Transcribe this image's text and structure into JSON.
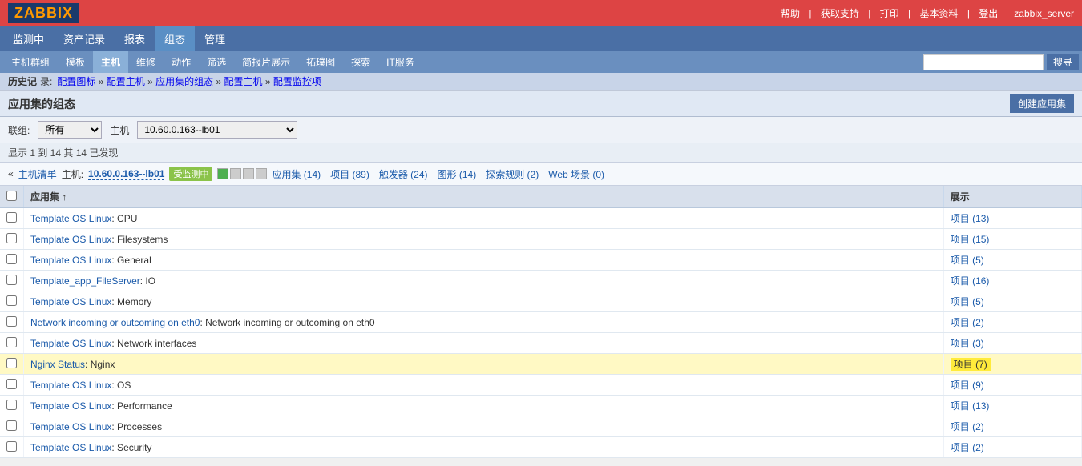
{
  "topBar": {
    "logo": "ZABBIX",
    "links": [
      "帮助",
      "获取支持",
      "打印",
      "基本资料",
      "登出"
    ],
    "serverName": "zabbix_server"
  },
  "mainNav": {
    "items": [
      "监测中",
      "资产记录",
      "报表",
      "组态",
      "管理"
    ],
    "activeIndex": 3
  },
  "subNav": {
    "items": [
      "主机群组",
      "模板",
      "主机",
      "维修",
      "动作",
      "筛选",
      "简报片展示",
      "拓璞图",
      "探索",
      "IT服务"
    ],
    "activeIndex": 2,
    "searchPlaceholder": "",
    "searchButton": "搜寻"
  },
  "breadcrumb": {
    "title": "历史记",
    "label": "录:",
    "items": [
      "配置图标",
      "配置主机",
      "应用集的组态",
      "配置主机",
      "配置监控项"
    ]
  },
  "pageSection": {
    "title": "应用集的组态",
    "createButton": "创建应用集"
  },
  "filterBar": {
    "groupLabel": "联组:",
    "groupValue": "所有",
    "hostLabel": "主机",
    "hostValue": "10.60.0.163--lb01",
    "groupOptions": [
      "所有"
    ],
    "hostOptions": [
      "10.60.0.163--lb01"
    ]
  },
  "infoBar": {
    "text": "显示 1 到 14 其 14 已发现"
  },
  "hostNav": {
    "prefix": "«",
    "listLabel": "主机清单",
    "separator1": "主机:",
    "hostLink": "10.60.0.163--lb01",
    "monitoringLabel": "受监测中",
    "statusIcons": [
      "green",
      "gray",
      "gray",
      "gray"
    ],
    "links": [
      {
        "label": "应用集 (14)",
        "count": 14
      },
      {
        "label": "项目 (89)",
        "count": 89
      },
      {
        "label": "触发器 (24)",
        "count": 24
      },
      {
        "label": "图形 (14)",
        "count": 14
      },
      {
        "label": "探索规则 (2)",
        "count": 2
      },
      {
        "label": "Web 场景 (0)",
        "count": 0
      }
    ]
  },
  "table": {
    "columns": [
      "应用集",
      "展示"
    ],
    "rows": [
      {
        "name": "Template OS Linux",
        "nameSuffix": ": CPU",
        "link1": "Template OS Linux",
        "display": "项目 (13)",
        "highlighted": false
      },
      {
        "name": "Template OS Linux",
        "nameSuffix": ": Filesystems",
        "link1": "Template OS Linux",
        "display": "项目 (15)",
        "highlighted": false
      },
      {
        "name": "Template OS Linux",
        "nameSuffix": ": General",
        "link1": "Template OS Linux",
        "display": "项目 (5)",
        "highlighted": false
      },
      {
        "name": "Template_app_FileServer",
        "nameSuffix": ": IO",
        "link1": "Template_app_FileServer",
        "display": "项目 (16)",
        "highlighted": false
      },
      {
        "name": "Template OS Linux",
        "nameSuffix": ": Memory",
        "link1": "Template OS Linux",
        "display": "项目 (5)",
        "highlighted": false
      },
      {
        "name": "Network incoming or outcoming on eth0",
        "nameSuffix": ": Network incoming or outcoming on eth0",
        "link1": "Network incoming or outcoming on eth0",
        "display": "项目 (2)",
        "highlighted": false
      },
      {
        "name": "Template OS Linux",
        "nameSuffix": ": Network interfaces",
        "link1": "Template OS Linux",
        "display": "项目 (3)",
        "highlighted": false
      },
      {
        "name": "Nginx Status",
        "nameSuffix": ": Nginx",
        "link1": "Nginx Status",
        "display": "项目 (7)",
        "highlighted": true
      },
      {
        "name": "Template OS Linux",
        "nameSuffix": ": OS",
        "link1": "Template OS Linux",
        "display": "项目 (9)",
        "highlighted": false
      },
      {
        "name": "Template OS Linux",
        "nameSuffix": ": Performance",
        "link1": "Template OS Linux",
        "display": "项目 (13)",
        "highlighted": false
      },
      {
        "name": "Template OS Linux",
        "nameSuffix": ": Processes",
        "link1": "Template OS Linux",
        "display": "项目 (2)",
        "highlighted": false
      },
      {
        "name": "Template OS Linux",
        "nameSuffix": ": Security",
        "link1": "Template OS Linux",
        "display": "项目 (2)",
        "highlighted": false
      }
    ]
  }
}
